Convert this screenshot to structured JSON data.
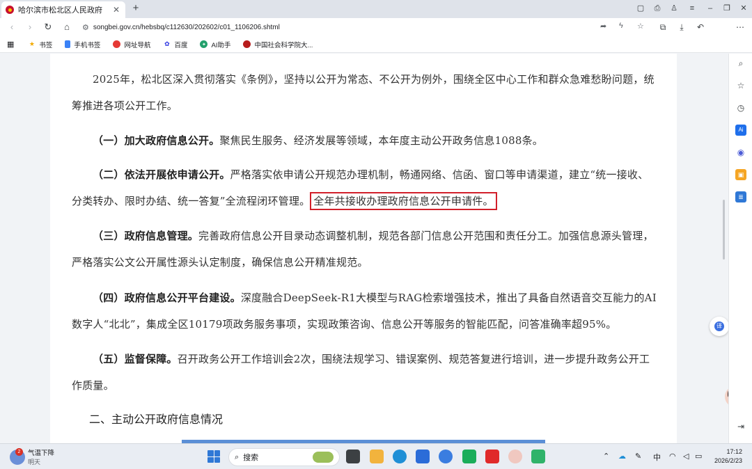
{
  "tab": {
    "title": "哈尔滨市松北区人民政府",
    "close": "✕",
    "new_tab": "+"
  },
  "address": {
    "url": "songbei.gov.cn/hebsbq/c112630/202602/c01_1106206.shtml"
  },
  "bookmarks": [
    {
      "label": "书签",
      "icon": "star-icon"
    },
    {
      "label": "手机书签",
      "icon": "phone-bookmark-icon"
    },
    {
      "label": "网址导航",
      "icon": "navigation-icon"
    },
    {
      "label": "百度",
      "icon": "baidu-icon"
    },
    {
      "label": "AI助手",
      "icon": "ai-assistant-icon"
    },
    {
      "label": "中国社会科学院大...",
      "icon": "cass-icon"
    }
  ],
  "article": {
    "intro": "2025年，松北区深入贯彻落实《条例》，坚持以公开为常态、不公开为例外，围绕全区中心工作和群众急难愁盼问题，统筹推进各项公开工作。",
    "p1_title": "（一）加大政府信息公开。",
    "p1_body": "聚焦民生服务、经济发展等领域，本年度主动公开政务信息1088条。",
    "p2_title": "（二）依法开展依申请公开。",
    "p2_body": "严格落实依申请公开规范办理机制，畅通网络、信函、窗口等申请渠道，建立“统一接收、分类转办、限时办结、统一答复”全流程闭环管理。",
    "p2_highlight": "全年共接收办理政府信息公开申请件。",
    "p3_title": "（三）政府信息管理。",
    "p3_body": "完善政府信息公开目录动态调整机制，规范各部门信息公开范围和责任分工。加强信息源头管理，严格落实公文公开属性源头认定制度，确保信息公开精准规范。",
    "p4_title": "（四）政府信息公开平台建设。",
    "p4_body": "深度融合DeepSeek-R1大模型与RAG检索增强技术，推出了具备自然语音交互能力的AI数字人“北北”，集成全区10179项政务服务事项，实现政策咨询、信息公开等服务的智能匹配，问答准确率超95%。",
    "p5_title": "（五）监督保障。",
    "p5_body": "召开政务公开工作培训会2次，围绕法规学习、错误案例、规范答复进行培训，进一步提升政务公开工作质量。",
    "section_heading": "二、主动公开政府信息情况"
  },
  "floating": {
    "translate": "译"
  },
  "taskbar": {
    "weather_title": "气温下降",
    "weather_sub": "明天",
    "weather_badge": "2",
    "search": "搜索",
    "ime": "中",
    "time": "17:12",
    "date": "2026/2/23"
  },
  "colors": {
    "highlight_border": "#d21f2a",
    "accent": "#2f78d6"
  }
}
